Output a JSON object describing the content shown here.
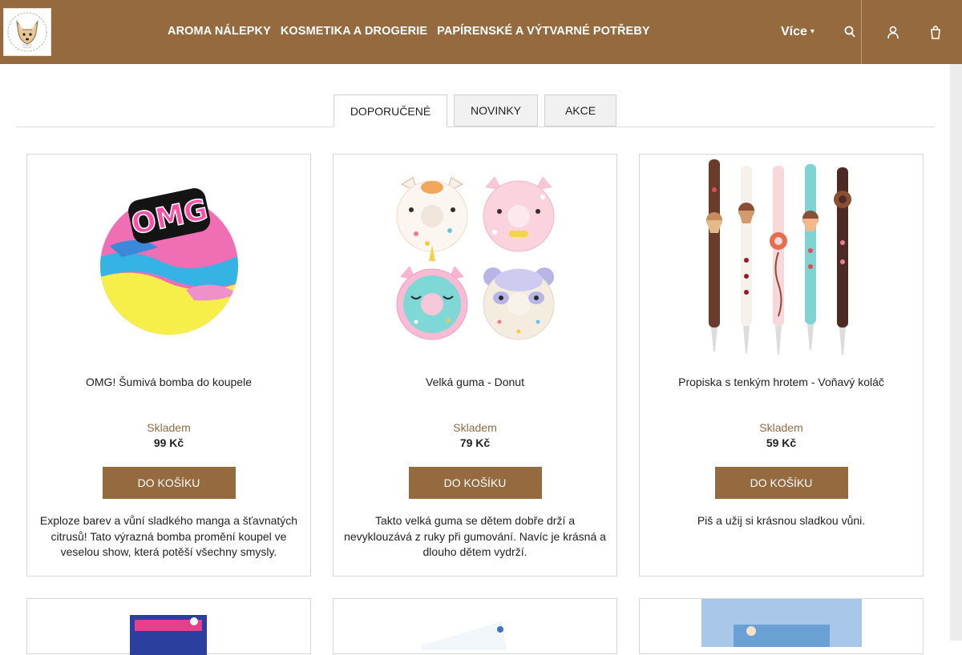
{
  "header": {
    "logo_alt": "Shiko logo",
    "nav": [
      "AROMA NÁLEPKY",
      "KOSMETIKA A DROGERIE",
      "PAPÍRENSKÉ A VÝTVARNÉ POTŘEBY"
    ],
    "more_label": "Více",
    "icons": [
      "search-icon",
      "user-icon",
      "cart-icon"
    ]
  },
  "tabs": [
    "DOPORUČENÉ",
    "NOVINKY",
    "AKCE"
  ],
  "products": [
    {
      "name": "OMG! Šumivá bomba do koupele",
      "stock": "Skladem",
      "price": "99 Kč",
      "button": "DO KOŠÍKU",
      "description": "Exploze barev a vůní sladkého manga a šťavnatých citrusů! Tato výrazná bomba promění koupel ve veselou show, která potěší všechny smysly."
    },
    {
      "name": "Velká guma - Donut",
      "stock": "Skladem",
      "price": "79 Kč",
      "button": "DO KOŠÍKU",
      "description": "Takto velká guma se dětem dobře drží a nevyklouzává z ruky při gumování. Navíc je krásná a dlouho dětem vydrží."
    },
    {
      "name": "Propiska s tenkým hrotem - Voňavý koláč",
      "stock": "Skladem",
      "price": "59 Kč",
      "button": "DO KOŠÍKU",
      "description": "Piš a užij si krásnou sladkou vůni."
    }
  ],
  "colors": {
    "brand": "#946a3e",
    "stock_text": "#946a3e"
  }
}
